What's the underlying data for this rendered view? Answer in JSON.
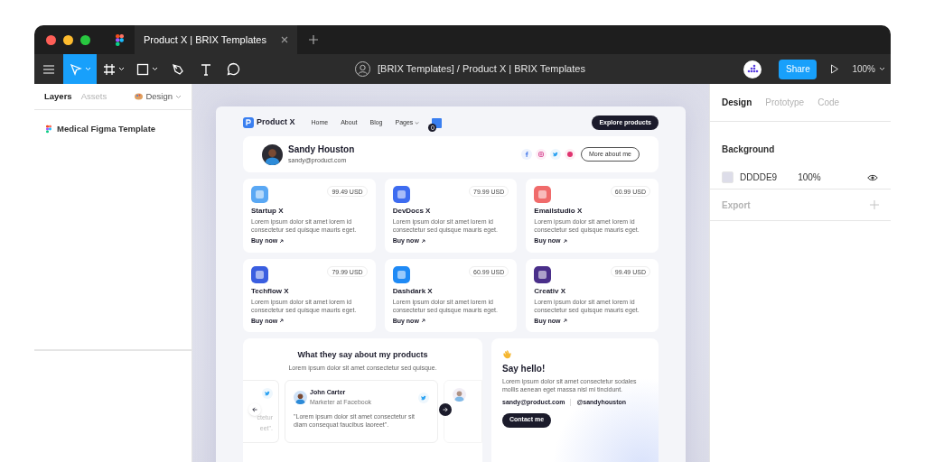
{
  "window": {
    "tab_title": "Product X | BRIX Templates",
    "file_title": "[BRIX Templates] / Product X | BRIX Templates"
  },
  "tools": [
    {
      "kind": "move",
      "selected": true,
      "dropdown": true
    },
    {
      "kind": "frame",
      "selected": false,
      "dropdown": true
    },
    {
      "kind": "rectangle",
      "selected": false,
      "dropdown": true
    },
    {
      "kind": "pen",
      "selected": false,
      "dropdown": false
    },
    {
      "kind": "text",
      "selected": false,
      "dropdown": false
    },
    {
      "kind": "comment",
      "selected": false,
      "dropdown": false
    }
  ],
  "toolbar_right": {
    "share": "Share",
    "zoom": "100%"
  },
  "left_panel": {
    "tabs": [
      {
        "label": "Layers",
        "selected": true
      },
      {
        "label": "Assets",
        "selected": false
      }
    ],
    "page_menu": "Design",
    "layers": [
      "Medical Figma Template"
    ]
  },
  "right_panel": {
    "tabs": [
      {
        "label": "Design",
        "selected": true
      },
      {
        "label": "Prototype",
        "selected": false
      },
      {
        "label": "Code",
        "selected": false
      }
    ],
    "background": {
      "title": "Background",
      "color": "#dddde9",
      "hex": "DDDDE9",
      "opacity": "100%"
    },
    "export": {
      "title": "Export",
      "disabled": true
    }
  },
  "canvas": {
    "nav": {
      "brand": "Product X",
      "links": [
        "Home",
        "About",
        "Blog",
        "Pages"
      ],
      "cart_count": "0",
      "cta": "Explore products"
    },
    "profile": {
      "name": "Sandy Houston",
      "email": "sandy@product.com",
      "socials": [
        {
          "kind": "facebook"
        },
        {
          "kind": "instagram"
        },
        {
          "kind": "twitter"
        },
        {
          "kind": "dribbble"
        }
      ],
      "button": "More about me"
    },
    "products": [
      {
        "name": "Startup X",
        "price": "99.49 USD",
        "color": "#5aa8f4",
        "desc": "Lorem ipsum dolor sit amet  lorem id consectetur sed quisque mauris eget.",
        "link": "Buy now"
      },
      {
        "name": "DevDocs X",
        "price": "79.99 USD",
        "color": "#3e6cf0",
        "desc": "Lorem ipsum dolor sit amet  lorem id consectetur sed quisque mauris eget.",
        "link": "Buy now"
      },
      {
        "name": "Emailstudio X",
        "price": "60.99 USD",
        "color": "#f06b6b",
        "desc": "Lorem ipsum dolor sit amet  lorem id consectetur sed quisque mauris eget.",
        "link": "Buy now"
      },
      {
        "name": "Techflow X",
        "price": "79.99 USD",
        "color": "#3a5ee0",
        "desc": "Lorem ipsum dolor sit amet  lorem id consectetur sed quisque mauris eget.",
        "link": "Buy now"
      },
      {
        "name": "Dashdark X",
        "price": "60.99 USD",
        "color": "#1f8af5",
        "desc": "Lorem ipsum dolor sit amet  lorem id consectetur sed quisque mauris eget.",
        "link": "Buy now"
      },
      {
        "name": "Creativ X",
        "price": "99.49 USD",
        "color": "#4a2f8a",
        "desc": "Lorem ipsum dolor sit amet  lorem id consectetur sed quisque mauris eget.",
        "link": "Buy now"
      }
    ],
    "testimonials": {
      "title": "What they say about my products",
      "subtitle": "Lorem ipsum dolor sit amet consectetur sed quisque.",
      "left_fragment": [
        "ctetur",
        "eet\"."
      ],
      "card": {
        "name": "John Carter",
        "role": "Marketer at Facebook",
        "quote": "\"Lorem ipsum dolor sit amet consectetur sit diam consequat faucibus laoreet\"."
      }
    },
    "contact": {
      "title": "Say hello!",
      "text": "Lorem ipsum dolor sit amet consectetur sodales mollis aenean eget massa nisl mi tincidunt.",
      "email": "sandy@product.com",
      "handle": "@sandyhouston",
      "button": "Contact me"
    }
  }
}
